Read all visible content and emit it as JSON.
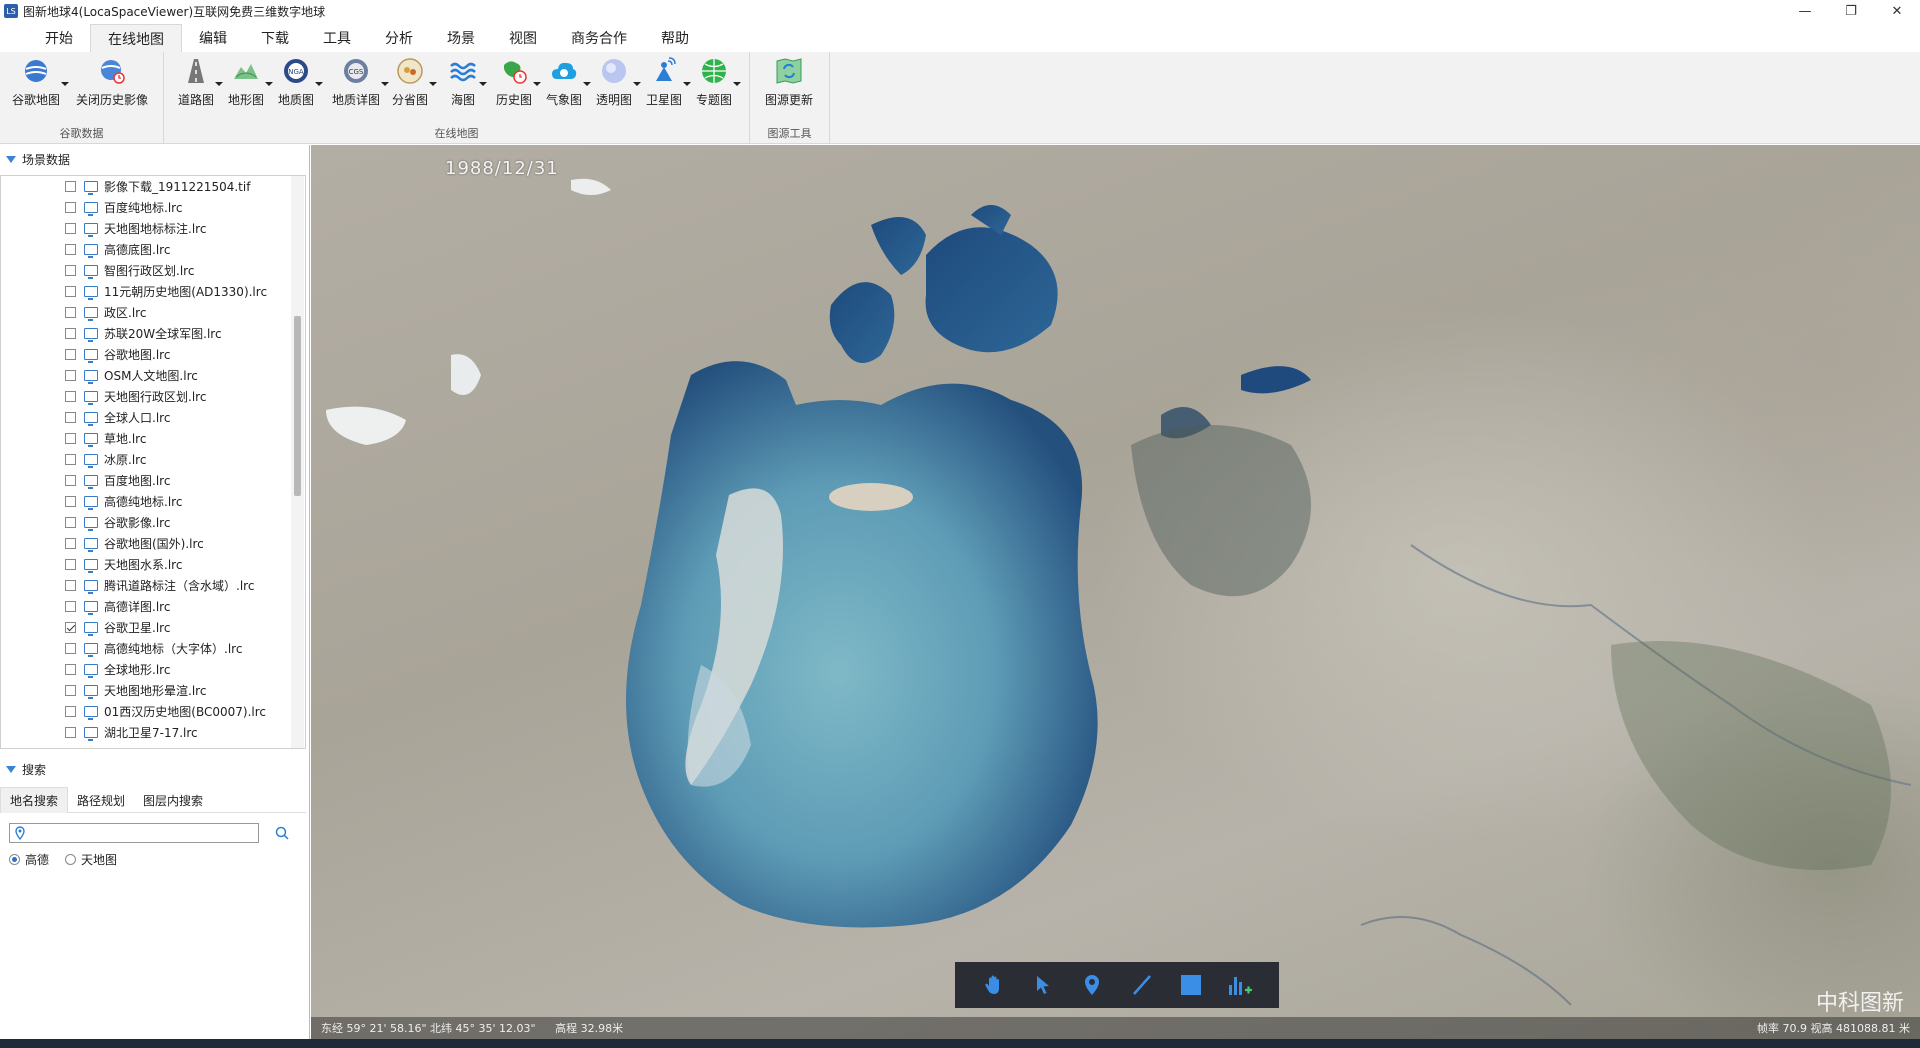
{
  "window": {
    "icon_text": "LS",
    "title": "图新地球4(LocaSpaceViewer)互联网免费三维数字地球",
    "controls": [
      "—",
      "❐",
      "✕"
    ]
  },
  "menu": [
    "开始",
    "在线地图",
    "编辑",
    "下载",
    "工具",
    "分析",
    "场景",
    "视图",
    "商务合作",
    "帮助"
  ],
  "ribbon": {
    "groups": [
      {
        "title": "谷歌数据",
        "buttons": [
          {
            "label": "谷歌地图",
            "icon": "google-globe-icon",
            "dropdown": true
          },
          {
            "label": "关闭历史影像",
            "icon": "history-globe-icon",
            "dropdown": false
          }
        ]
      },
      {
        "title": "在线地图",
        "buttons": [
          {
            "label": "道路图",
            "icon": "road-icon",
            "dropdown": true
          },
          {
            "label": "地形图",
            "icon": "terrain-icon",
            "dropdown": true
          },
          {
            "label": "地质图",
            "icon": "nga-icon",
            "dropdown": true
          },
          {
            "label": "地质详图",
            "icon": "cgs-icon",
            "dropdown": true
          },
          {
            "label": "分省图",
            "icon": "province-icon",
            "dropdown": true
          },
          {
            "label": "海图",
            "icon": "sea-icon",
            "dropdown": true
          },
          {
            "label": "历史图",
            "icon": "history-map-icon",
            "dropdown": true
          },
          {
            "label": "气象图",
            "icon": "weather-icon",
            "dropdown": true
          },
          {
            "label": "透明图",
            "icon": "transparent-icon",
            "dropdown": true
          },
          {
            "label": "卫星图",
            "icon": "satellite-icon",
            "dropdown": true
          },
          {
            "label": "专题图",
            "icon": "thematic-icon",
            "dropdown": true
          }
        ]
      },
      {
        "title": "图源工具",
        "buttons": [
          {
            "label": "图源更新",
            "icon": "source-update-icon",
            "dropdown": false
          }
        ]
      }
    ]
  },
  "scene_panel": {
    "title": "场景数据",
    "items": [
      {
        "label": "影像下载_1911221504.tif",
        "checked": false
      },
      {
        "label": "百度纯地标.lrc",
        "checked": false
      },
      {
        "label": "天地图地标标注.lrc",
        "checked": false
      },
      {
        "label": "高德底图.lrc",
        "checked": false
      },
      {
        "label": "智图行政区划.lrc",
        "checked": false
      },
      {
        "label": "11元朝历史地图(AD1330).lrc",
        "checked": false
      },
      {
        "label": "政区.lrc",
        "checked": false
      },
      {
        "label": "苏联20W全球军图.lrc",
        "checked": false
      },
      {
        "label": "谷歌地图.lrc",
        "checked": false
      },
      {
        "label": "OSM人文地图.lrc",
        "checked": false
      },
      {
        "label": "天地图行政区划.lrc",
        "checked": false
      },
      {
        "label": "全球人口.lrc",
        "checked": false
      },
      {
        "label": "草地.lrc",
        "checked": false
      },
      {
        "label": "冰原.lrc",
        "checked": false
      },
      {
        "label": "百度地图.lrc",
        "checked": false
      },
      {
        "label": "高德纯地标.lrc",
        "checked": false
      },
      {
        "label": "谷歌影像.lrc",
        "checked": false
      },
      {
        "label": "谷歌地图(国外).lrc",
        "checked": false
      },
      {
        "label": "天地图水系.lrc",
        "checked": false
      },
      {
        "label": "腾讯道路标注（含水域）.lrc",
        "checked": false
      },
      {
        "label": "高德详图.lrc",
        "checked": false
      },
      {
        "label": "谷歌卫星.lrc",
        "checked": true
      },
      {
        "label": "高德纯地标（大字体）.lrc",
        "checked": false
      },
      {
        "label": "全球地形.lrc",
        "checked": false
      },
      {
        "label": "天地图地形晕渲.lrc",
        "checked": false
      },
      {
        "label": "01西汉历史地图(BC0007).lrc",
        "checked": false
      },
      {
        "label": "湖北卫星7-17.lrc",
        "checked": false
      }
    ]
  },
  "search_panel": {
    "title": "搜索",
    "tabs": [
      "地名搜索",
      "路径规划",
      "图层内搜索"
    ],
    "input_value": "",
    "radio_options": [
      {
        "label": "高德",
        "selected": true
      },
      {
        "label": "天地图",
        "selected": false
      }
    ]
  },
  "map": {
    "date": "1988/12/31",
    "brand": "中科图新",
    "toolbar": [
      "hand-icon",
      "pointer-icon",
      "pin-icon",
      "line-icon",
      "rectangle-icon",
      "chart-add-icon"
    ]
  },
  "status": {
    "coords": "东经 59° 21' 58.16\"  北纬 45° 35' 12.03\"",
    "altitude": "高程 32.98米",
    "right": "帧率 70.9  视高 481088.81 米"
  },
  "colors": {
    "accent": "#3c82d6",
    "ribbon_bg": "#f2f2f2",
    "toolbar_bg": "#2a2d34"
  }
}
